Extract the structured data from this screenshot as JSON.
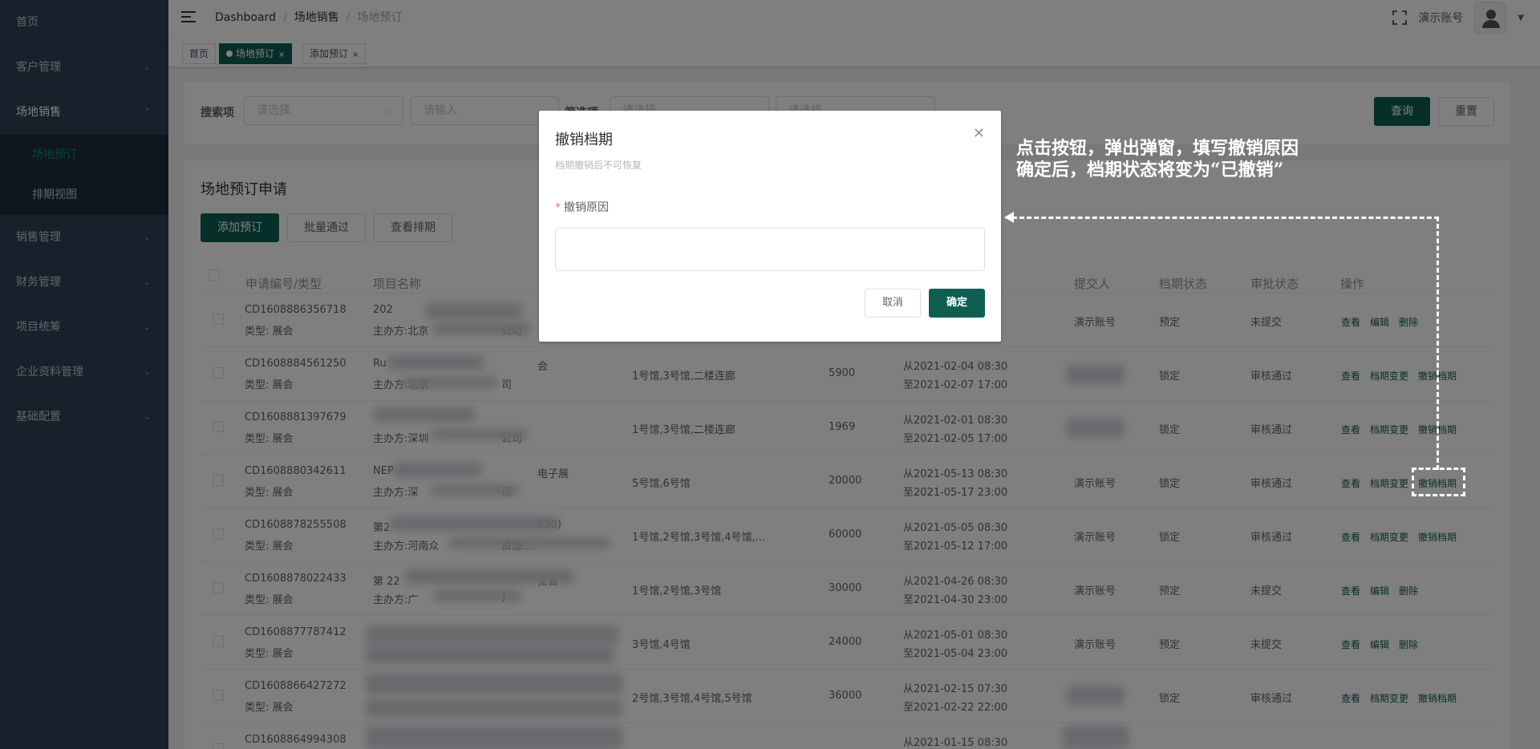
{
  "sidebar": {
    "items": [
      {
        "label": "首页"
      },
      {
        "label": "客户管理"
      },
      {
        "label": "场地销售"
      },
      {
        "label": "销售管理"
      },
      {
        "label": "财务管理"
      },
      {
        "label": "项目统筹"
      },
      {
        "label": "企业资料管理"
      },
      {
        "label": "基础配置"
      }
    ],
    "sub_items": [
      {
        "label": "场地预订"
      },
      {
        "label": "排期视图"
      }
    ]
  },
  "navbar": {
    "breadcrumb": [
      "Dashboard",
      "场地销售",
      "场地预订"
    ],
    "account_name": "演示账号"
  },
  "tags": [
    {
      "label": "首页"
    },
    {
      "label": "场地预订"
    },
    {
      "label": "添加预订"
    }
  ],
  "search": {
    "label": "搜索项",
    "select_placeholder": "请选择",
    "input_placeholder": "请输入",
    "filter_label": "筛选项",
    "filter1_placeholder": "请选择",
    "filter2_placeholder": "请选择",
    "query_button": "查询",
    "reset_button": "重置"
  },
  "table": {
    "title": "场地预订申请",
    "add_button": "添加预订",
    "batch_button": "批量通过",
    "schedule_button": "查看排期",
    "headers": [
      "申请编号/类型",
      "项目名称",
      "提交人",
      "档期状态",
      "审批状态",
      "操作"
    ],
    "rows": [
      {
        "code": "CD1608886356718",
        "type": "类型: 展会",
        "name": "202",
        "org": "主办方:北京",
        "org_tail": "公司",
        "halls": "",
        "area": "",
        "from": "",
        "to": "",
        "submitter": "演示账号",
        "status": "预定",
        "approval": "未提交",
        "ops": [
          "查看",
          "编辑",
          "删除"
        ]
      },
      {
        "code": "CD1608884561250",
        "type": "类型: 展会",
        "name": "Ru",
        "name_tail": "会",
        "org": "主办方:北京",
        "org_tail": "司",
        "halls": "1号馆,3号馆,二楼连廊",
        "area": "5900",
        "from": "从2021-02-04 08:30",
        "to": "至2021-02-07 17:00",
        "submitter": "",
        "status": "锁定",
        "approval": "审核通过",
        "ops": [
          "查看",
          "档期变更",
          "撤销档期"
        ]
      },
      {
        "code": "CD1608881397679",
        "type": "类型: 展会",
        "name": "",
        "org": "主办方:深圳",
        "org_tail": "公司",
        "halls": "1号馆,3号馆,二楼连廊",
        "area": "1969",
        "from": "从2021-02-01 08:30",
        "to": "至2021-02-05 17:00",
        "submitter": "",
        "status": "锁定",
        "approval": "审核通过",
        "ops": [
          "查看",
          "档期变更",
          "撤销档期"
        ]
      },
      {
        "code": "CD1608880342611",
        "type": "类型: 展会",
        "name": "NEP",
        "name_tail": "电子展",
        "org": "主办方:深",
        "org_tail": "司",
        "halls": "5号馆,6号馆",
        "area": "20000",
        "from": "从2021-05-13 08:30",
        "to": "至2021-05-17 23:00",
        "submitter": "演示账号",
        "status": "锁定",
        "approval": "审核通过",
        "ops": [
          "查看",
          "档期变更",
          "撤销档期"
        ]
      },
      {
        "code": "CD1608878255508",
        "type": "类型: 展会",
        "name": "第2",
        "name_tail": "020)",
        "org": "主办方:河南众",
        "org_tail": "资源...",
        "halls": "1号馆,2号馆,3号馆,4号馆,...",
        "area": "60000",
        "from": "从2021-05-05 08:30",
        "to": "至2021-05-12 17:00",
        "submitter": "演示账号",
        "status": "锁定",
        "approval": "审核通过",
        "ops": [
          "查看",
          "档期变更",
          "撤销档期"
        ]
      },
      {
        "code": "CD1608878022433",
        "type": "类型: 展会",
        "name": "第 22",
        "name_tail": "览会",
        "org": "主办方:广",
        "org_tail": "]",
        "halls": "1号馆,2号馆,3号馆",
        "area": "30000",
        "from": "从2021-04-26 08:30",
        "to": "至2021-04-30 23:00",
        "submitter": "演示账号",
        "status": "预定",
        "approval": "未提交",
        "ops": [
          "查看",
          "编辑",
          "删除"
        ]
      },
      {
        "code": "CD1608877787412",
        "type": "类型: 展会",
        "name": "",
        "org": "",
        "org_tail": "",
        "halls": "3号馆,4号馆",
        "area": "24000",
        "from": "从2021-05-01 08:30",
        "to": "至2021-05-04 23:00",
        "submitter": "演示账号",
        "status": "预定",
        "approval": "未提交",
        "ops": [
          "查看",
          "编辑",
          "删除"
        ]
      },
      {
        "code": "CD1608866427272",
        "type": "类型: 展会",
        "name": "",
        "org": "",
        "org_tail": "",
        "halls": "2号馆,3号馆,4号馆,5号馆",
        "area": "36000",
        "from": "从2021-02-15 07:30",
        "to": "至2021-02-22 22:00",
        "submitter": "",
        "status": "锁定",
        "approval": "审核通过",
        "ops": [
          "查看",
          "档期变更",
          "撤销档期"
        ]
      },
      {
        "code": "CD1608864994308",
        "type": "",
        "name": "",
        "org": "",
        "org_tail": "",
        "halls": "",
        "area": "",
        "from": "从2021-01-15 08:30",
        "to": "",
        "submitter": "",
        "status": "",
        "approval": "",
        "ops": []
      }
    ]
  },
  "dialog": {
    "title": "撤销档期",
    "hint": "档期撤销后不可恢复",
    "field_label": "撤销原因",
    "required_mark": "*",
    "textarea_value": "",
    "cancel": "取消",
    "confirm": "确定"
  },
  "annotation": {
    "line1": "点击按钮，弹出弹窗，填写撤销原因",
    "line2": "确定后，档期状态将变为“已撤销”"
  },
  "colors": {
    "primary": "#0e5e53",
    "sidebar_bg": "#304156"
  }
}
